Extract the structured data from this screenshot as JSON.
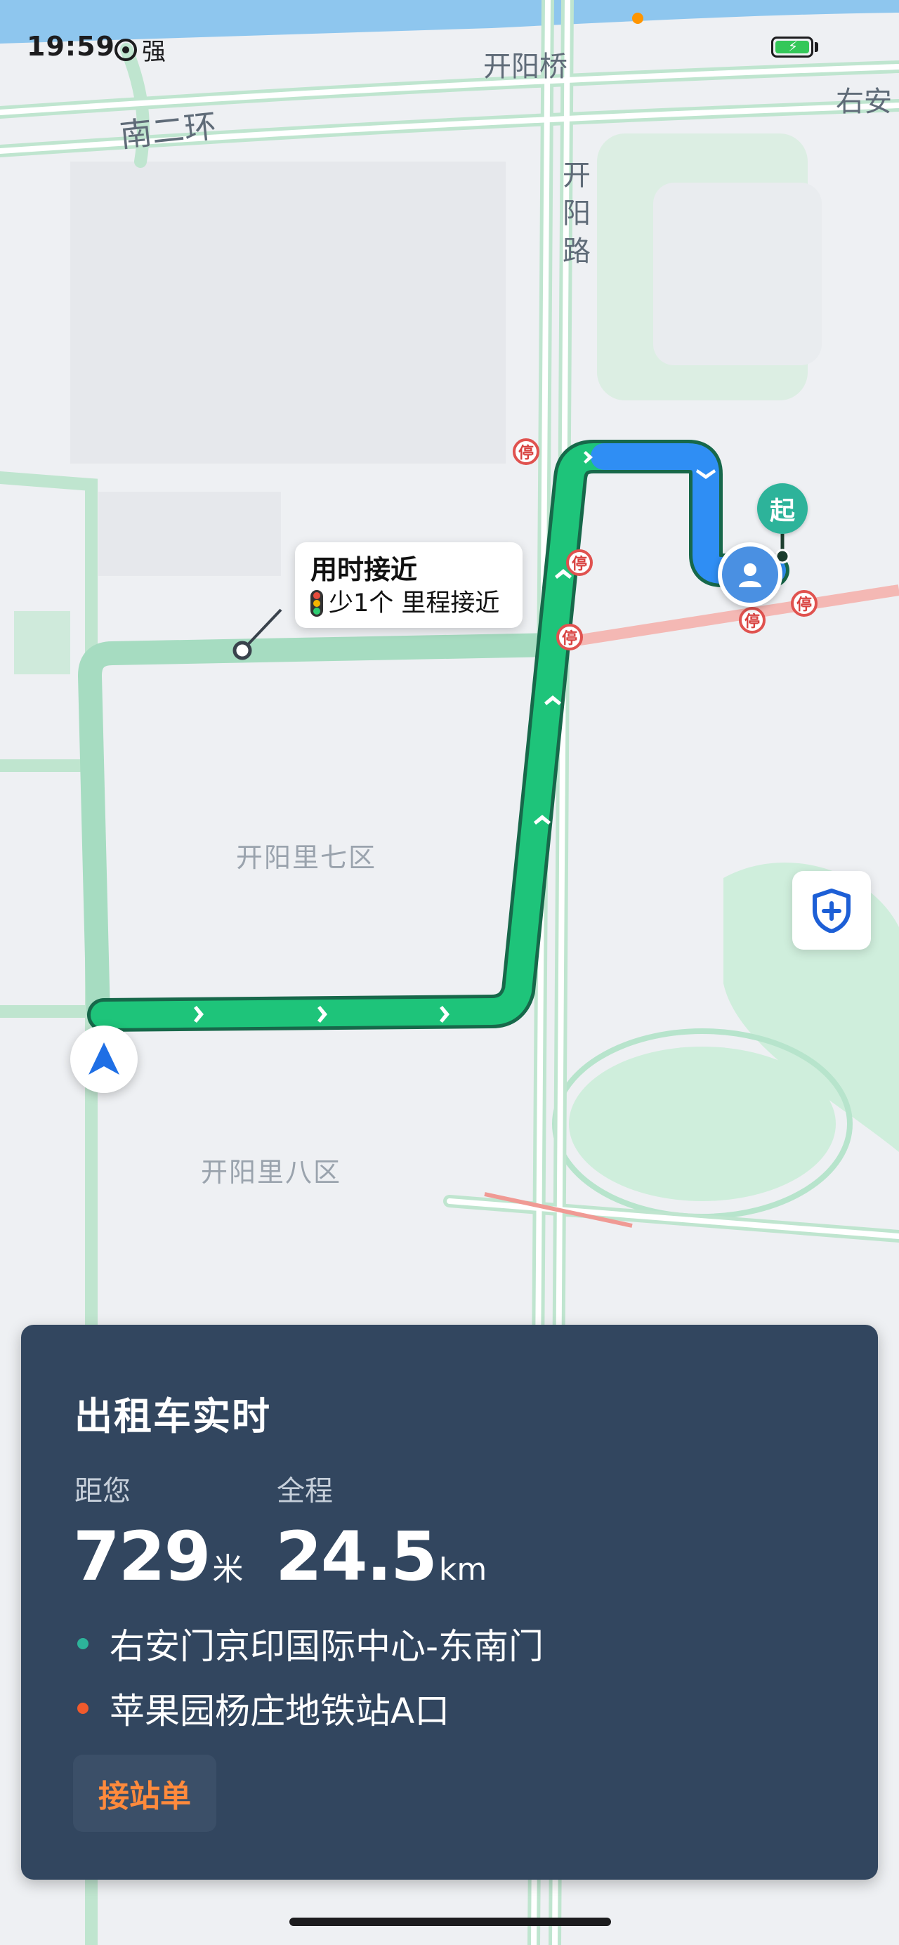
{
  "status_bar": {
    "time": "19:59",
    "signal_label": "强"
  },
  "map": {
    "labels": {
      "bridge": "开阳桥",
      "ring_road": "南二环",
      "road_right": "右安",
      "road_vertical": "开阳路",
      "area_7": "开阳里七区",
      "area_8": "开阳里八区"
    },
    "stop_sign": "停",
    "route_bubble": {
      "title": "用时接近",
      "subtitle": "少1个 里程接近"
    },
    "start_marker": "起",
    "icons": {
      "navigation": "navigation-arrow-icon",
      "passenger": "user-icon",
      "safety": "shield-plus-icon"
    },
    "colors": {
      "route_primary": "#1ec47a",
      "route_alt": "#a6dcc1",
      "route_blue": "#2f8ef4",
      "start": "#2db39a",
      "destination_dot": "#f05a2c"
    }
  },
  "card": {
    "title": "出租车实时",
    "distance_to_you": {
      "label": "距您",
      "value": "729",
      "unit": "米"
    },
    "total": {
      "label": "全程",
      "value": "24.5",
      "unit": "km"
    },
    "origin": "右安门京印国际中心-东南门",
    "destination": "苹果园杨庄地铁站A口",
    "pickup_button": "接站单"
  }
}
